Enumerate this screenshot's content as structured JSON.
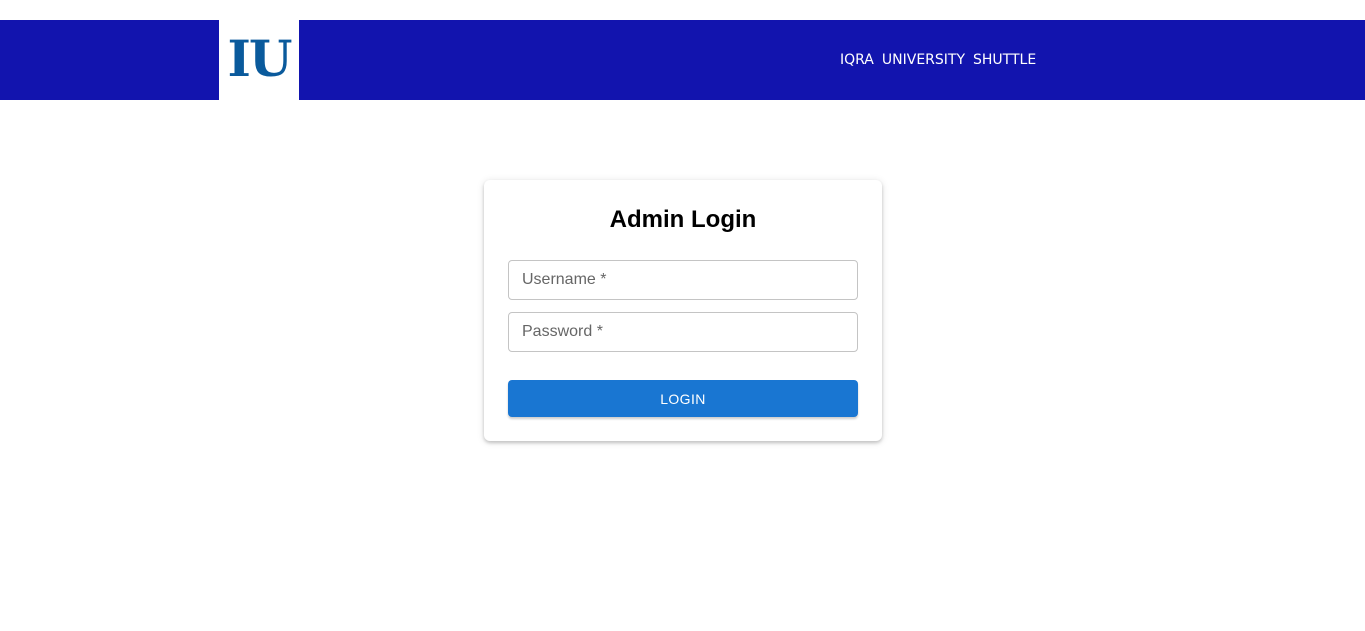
{
  "header": {
    "logo_text": "IU",
    "brand_words": [
      "IQRA",
      "UNIVERSITY",
      "SHUTTLE"
    ],
    "background_color": "#1214ae",
    "logo_color": "#0a5a9c"
  },
  "login": {
    "title": "Admin Login",
    "username_placeholder": "Username *",
    "password_placeholder": "Password *",
    "username_value": "",
    "password_value": "",
    "submit_label": "LOGIN",
    "button_color": "#1976d2"
  }
}
